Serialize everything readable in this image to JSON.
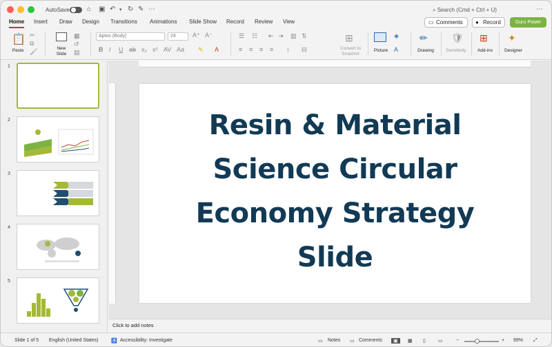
{
  "titlebar": {
    "autosave_label": "AutoSave",
    "search_placeholder": "Search (Cmd + Ctrl + U)"
  },
  "tabs": [
    "Home",
    "Insert",
    "Draw",
    "Design",
    "Transitions",
    "Animations",
    "Slide Show",
    "Record",
    "Review",
    "View"
  ],
  "actions": {
    "comments": "Comments",
    "record": "Record",
    "guru": "Guru Power"
  },
  "ribbon": {
    "paste": "Paste",
    "new_slide": "New Slide",
    "font_name": "Aptos (Body)",
    "font_size": "24",
    "convert_smartart": "Convert to SmartArt",
    "picture": "Picture",
    "drawing": "Drawing",
    "sensitivity": "Sensitivity",
    "addins": "Add-ins",
    "designer": "Designer"
  },
  "thumbnails": [
    {
      "num": "1"
    },
    {
      "num": "2"
    },
    {
      "num": "3"
    },
    {
      "num": "4"
    },
    {
      "num": "5"
    }
  ],
  "slide": {
    "title": "Resin & Material Science Circular Economy Strategy Slide"
  },
  "notes_placeholder": "Click to add notes",
  "status": {
    "slide_of": "Slide 1 of 5",
    "language": "English (United States)",
    "accessibility": "Accessibility: Investigate",
    "notes": "Notes",
    "comments": "Comments",
    "zoom": "99%"
  },
  "colors": {
    "accent": "#c43e1c",
    "title": "#123a55",
    "brand_green": "#7cb342",
    "thumb_green": "#a5b838",
    "navy": "#1f4e6e"
  }
}
